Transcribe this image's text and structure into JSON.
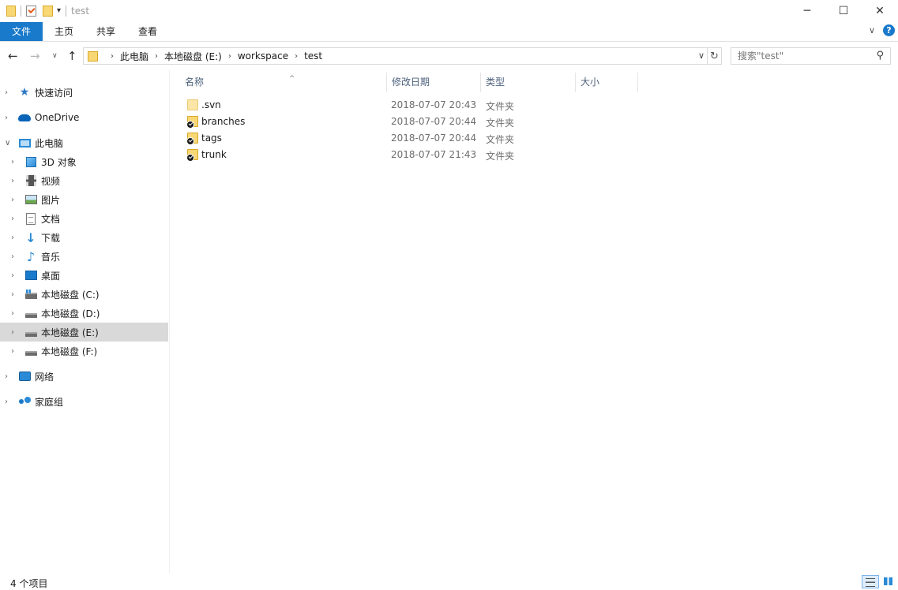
{
  "window": {
    "title": "test",
    "minimize_glyph": "─",
    "maximize_glyph": "☐",
    "close_glyph": "✕"
  },
  "quick_access_toolbar": {
    "dropdown_glyph": "▾"
  },
  "ribbon": {
    "tabs": [
      {
        "label": "文件",
        "active": true
      },
      {
        "label": "主页"
      },
      {
        "label": "共享"
      },
      {
        "label": "查看"
      }
    ],
    "expand_glyph": "∨",
    "help_glyph": "?"
  },
  "nav": {
    "back_glyph": "←",
    "forward_glyph": "→",
    "recent_glyph": "∨",
    "up_glyph": "↑",
    "breadcrumbs": [
      "此电脑",
      "本地磁盘 (E:)",
      "workspace",
      "test"
    ],
    "crumb_sep": "›",
    "dropdown_glyph": "∨",
    "refresh_glyph": "↻"
  },
  "search": {
    "placeholder": "搜索\"test\"",
    "value": ""
  },
  "sidebar": {
    "items": [
      {
        "label": "快速访问",
        "icon": "star-icon",
        "level": 0
      },
      {
        "label": "OneDrive",
        "icon": "cloud-icon",
        "level": 0
      },
      {
        "label": "此电脑",
        "icon": "computer-icon",
        "level": 0,
        "expanded": true
      },
      {
        "label": "3D 对象",
        "icon": "3d-objects-icon",
        "level": 1
      },
      {
        "label": "视频",
        "icon": "video-icon",
        "level": 1
      },
      {
        "label": "图片",
        "icon": "pictures-icon",
        "level": 1
      },
      {
        "label": "文档",
        "icon": "documents-icon",
        "level": 1
      },
      {
        "label": "下载",
        "icon": "download-icon",
        "level": 1
      },
      {
        "label": "音乐",
        "icon": "music-icon",
        "level": 1
      },
      {
        "label": "桌面",
        "icon": "desktop-icon",
        "level": 1
      },
      {
        "label": "本地磁盘 (C:)",
        "icon": "system-drive-icon",
        "level": 1
      },
      {
        "label": "本地磁盘 (D:)",
        "icon": "drive-icon",
        "level": 1
      },
      {
        "label": "本地磁盘 (E:)",
        "icon": "drive-icon",
        "level": 1,
        "selected": true
      },
      {
        "label": "本地磁盘 (F:)",
        "icon": "drive-icon",
        "level": 1
      },
      {
        "label": "网络",
        "icon": "network-icon",
        "level": 0
      },
      {
        "label": "家庭组",
        "icon": "homegroup-icon",
        "level": 0
      }
    ],
    "collapsed_glyph": "›",
    "expanded_glyph": "∨"
  },
  "file_list": {
    "columns": [
      "名称",
      "修改日期",
      "类型",
      "大小"
    ],
    "sort_glyph": "^",
    "rows": [
      {
        "name": ".svn",
        "modified": "2018-07-07 20:43",
        "type": "文件夹",
        "svn_badge": false
      },
      {
        "name": "branches",
        "modified": "2018-07-07 20:44",
        "type": "文件夹",
        "svn_badge": true
      },
      {
        "name": "tags",
        "modified": "2018-07-07 20:44",
        "type": "文件夹",
        "svn_badge": true
      },
      {
        "name": "trunk",
        "modified": "2018-07-07 21:43",
        "type": "文件夹",
        "svn_badge": true
      }
    ]
  },
  "status": {
    "item_count": "4 个项目"
  },
  "colors": {
    "accent": "#1979ca",
    "selection": "#d9d9d9",
    "folder": "#f8d775"
  }
}
